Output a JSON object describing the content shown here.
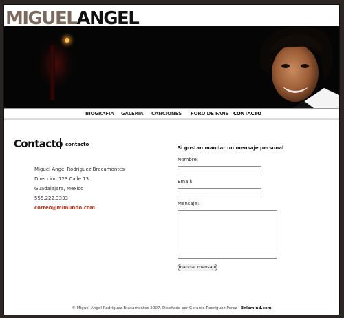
{
  "header": {
    "logo_first": "MIGUEL",
    "logo_last": "ANGEL"
  },
  "nav": {
    "items": [
      "BIOGRAFIA",
      "GALERIA",
      "CANCIONES",
      "FORO DE FANS",
      "CONTACTO"
    ],
    "active": "CONTACTO"
  },
  "page": {
    "title": "Contacto",
    "subtitle": "contacto"
  },
  "contact": {
    "name": "Miguel Angel Rodríguez Bracamontes",
    "street": "Direccion 123 Calle 13",
    "city": "Guadalajara, Mexico",
    "phone": "555.222.3333",
    "email": "correo@mimundo.com"
  },
  "form": {
    "heading": "Si gustan mandar un mensaje personal",
    "name_label": "Nombre:",
    "email_label": "Email:",
    "message_label": "Mensaje:",
    "name_value": "",
    "email_value": "",
    "message_value": "",
    "submit_label": "mandar mensaje"
  },
  "footer": {
    "text": "© Miguel Angel Rodríguez Bracamontes 2007. Diseñado por Gerardo Rodríguez-Perez -",
    "site": "3nlamind.com"
  },
  "colors": {
    "background": "#2b2623",
    "accent_link": "#b23a1c",
    "logo_first": "#7a6a5e"
  }
}
